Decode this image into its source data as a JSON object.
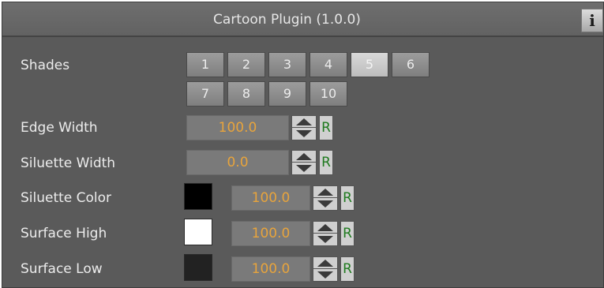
{
  "window": {
    "title": "Cartoon Plugin (1.0.0)",
    "info_label": "i"
  },
  "shades": {
    "label": "Shades",
    "selected": "5",
    "buttons": [
      "1",
      "2",
      "3",
      "4",
      "5",
      "6",
      "7",
      "8",
      "9",
      "10"
    ]
  },
  "edge_width": {
    "label": "Edge Width",
    "value": "100.0",
    "reset_label": "R"
  },
  "siluette_width": {
    "label": "Siluette Width",
    "value": "0.0",
    "reset_label": "R"
  },
  "siluette_color": {
    "label": "Siluette Color",
    "color": "#000000",
    "value": "100.0",
    "reset_label": "R"
  },
  "surface_high": {
    "label": "Surface High",
    "color": "#ffffff",
    "value": "100.0",
    "reset_label": "R"
  },
  "surface_low": {
    "label": "Surface Low",
    "color": "#222222",
    "value": "100.0",
    "reset_label": "R"
  },
  "colors": {
    "value_text": "#e8a43c",
    "reset_text": "#1f7a1f",
    "panel_bg": "#5a5a5a"
  }
}
